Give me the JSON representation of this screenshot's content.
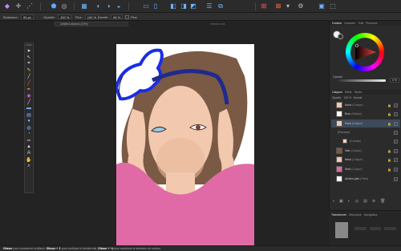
{
  "context_toolbar": {
    "width_label": "Épaisseur :",
    "width_value": "90 px",
    "opacity_label": "Opacité :",
    "opacity_value": "100 %",
    "flow_label": "Flux :",
    "flow_value": "100 %",
    "hardness_label": "Dureté :",
    "hardness_value": "80 %",
    "more_label": "Plus"
  },
  "document": {
    "tab_title": "Untitled.afphoto (19%)",
    "tab_secondary": "Version d.dl"
  },
  "tools_panel": {
    "title": "Outils"
  },
  "right_panel": {
    "color_tabs": [
      "Couleur",
      "Nuancier",
      "Trait",
      "Pinceaux"
    ],
    "opacity_label": "Opacité",
    "opacity_value": "0 %",
    "layer_tabs": [
      "Calques",
      "Effets",
      "Styles"
    ],
    "blend_label": "Opacité:",
    "blend_opacity": "100 %",
    "blend_mode": "Normal",
    "layers": [
      {
        "name": "Arms",
        "type": "(Calque)"
      },
      {
        "name": "Bow",
        "type": "(Calque)"
      },
      {
        "name": "Face",
        "type": "(Calque)"
      },
      {
        "name": "",
        "type": "(Pinceau)"
      },
      {
        "name": "",
        "type": "(Courbe)"
      },
      {
        "name": "Hair",
        "type": "(Calque)"
      },
      {
        "name": "Neck",
        "type": "(Calque)"
      },
      {
        "name": "Shirt",
        "type": "(Calque)"
      },
      {
        "name": "Arrière-plan",
        "type": "(Pixel)"
      }
    ],
    "bottom_tabs": [
      "Transformer",
      "Historique",
      "Navigateur"
    ]
  },
  "status_bar": {
    "part1_bold": "Glisser",
    "part1": "pour commencer à effacer.",
    "part2_bold": "Glisser + ⇧",
    "part2": "pour continuer le dernier trait.",
    "part3_bold": "Glisser + ⌥",
    "part3": "pour accentuer le sélecteur de couleur."
  },
  "colors": {
    "hair": "#7a5a45",
    "skin": "#f2c8ae",
    "shirt": "#e06aa6",
    "headband": "#1f2a8c",
    "bow_outline": "#1a2ee6",
    "selected_layer": "#3c4a5a"
  }
}
